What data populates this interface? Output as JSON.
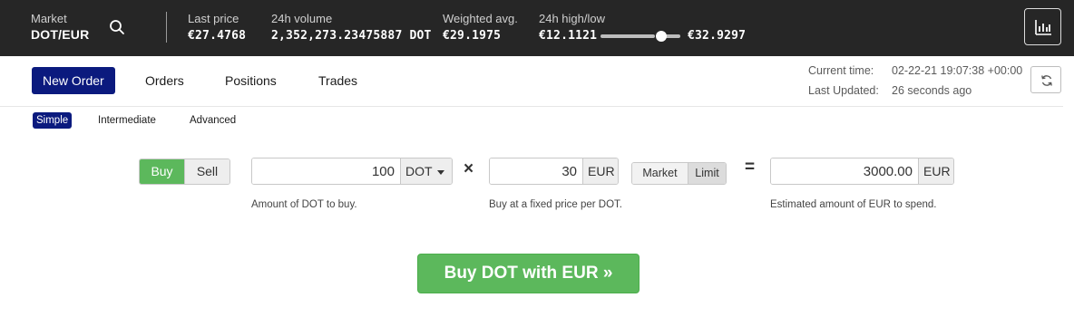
{
  "market": {
    "label": "Market",
    "pair": "DOT/EUR",
    "last_price_label": "Last price",
    "last_price": "€27.4768",
    "volume_label": "24h volume",
    "volume": "2,352,273.23475887 DOT",
    "weighted_label": "Weighted avg.",
    "weighted": "€29.1975",
    "highlow_label": "24h high/low",
    "low": "€12.1121",
    "high": "€32.9297",
    "range_position": 0.8
  },
  "tabs": [
    {
      "label": "New Order"
    },
    {
      "label": "Orders"
    },
    {
      "label": "Positions"
    },
    {
      "label": "Trades"
    }
  ],
  "status": {
    "current_time_label": "Current time:",
    "current_time": "02-22-21 19:07:38 +00:00",
    "last_updated_label": "Last Updated:",
    "last_updated": "26 seconds ago"
  },
  "order_types": [
    {
      "label": "Simple"
    },
    {
      "label": "Intermediate"
    },
    {
      "label": "Advanced"
    }
  ],
  "form": {
    "buy_label": "Buy",
    "sell_label": "Sell",
    "amount": "100",
    "amount_currency": "DOT",
    "amount_help": "Amount of DOT to buy.",
    "times_symbol": "×",
    "price": "30",
    "price_currency": "EUR",
    "price_help": "Buy at a fixed price per DOT.",
    "market_label": "Market",
    "limit_label": "Limit",
    "equals_symbol": "=",
    "total": "3000.00",
    "total_currency": "EUR",
    "total_help": "Estimated amount of EUR to spend.",
    "submit_label": "Buy DOT with EUR »"
  },
  "colors": {
    "topbar": "#262626",
    "active_tab": "#0b1a7e",
    "buy_green": "#5cb85c"
  }
}
